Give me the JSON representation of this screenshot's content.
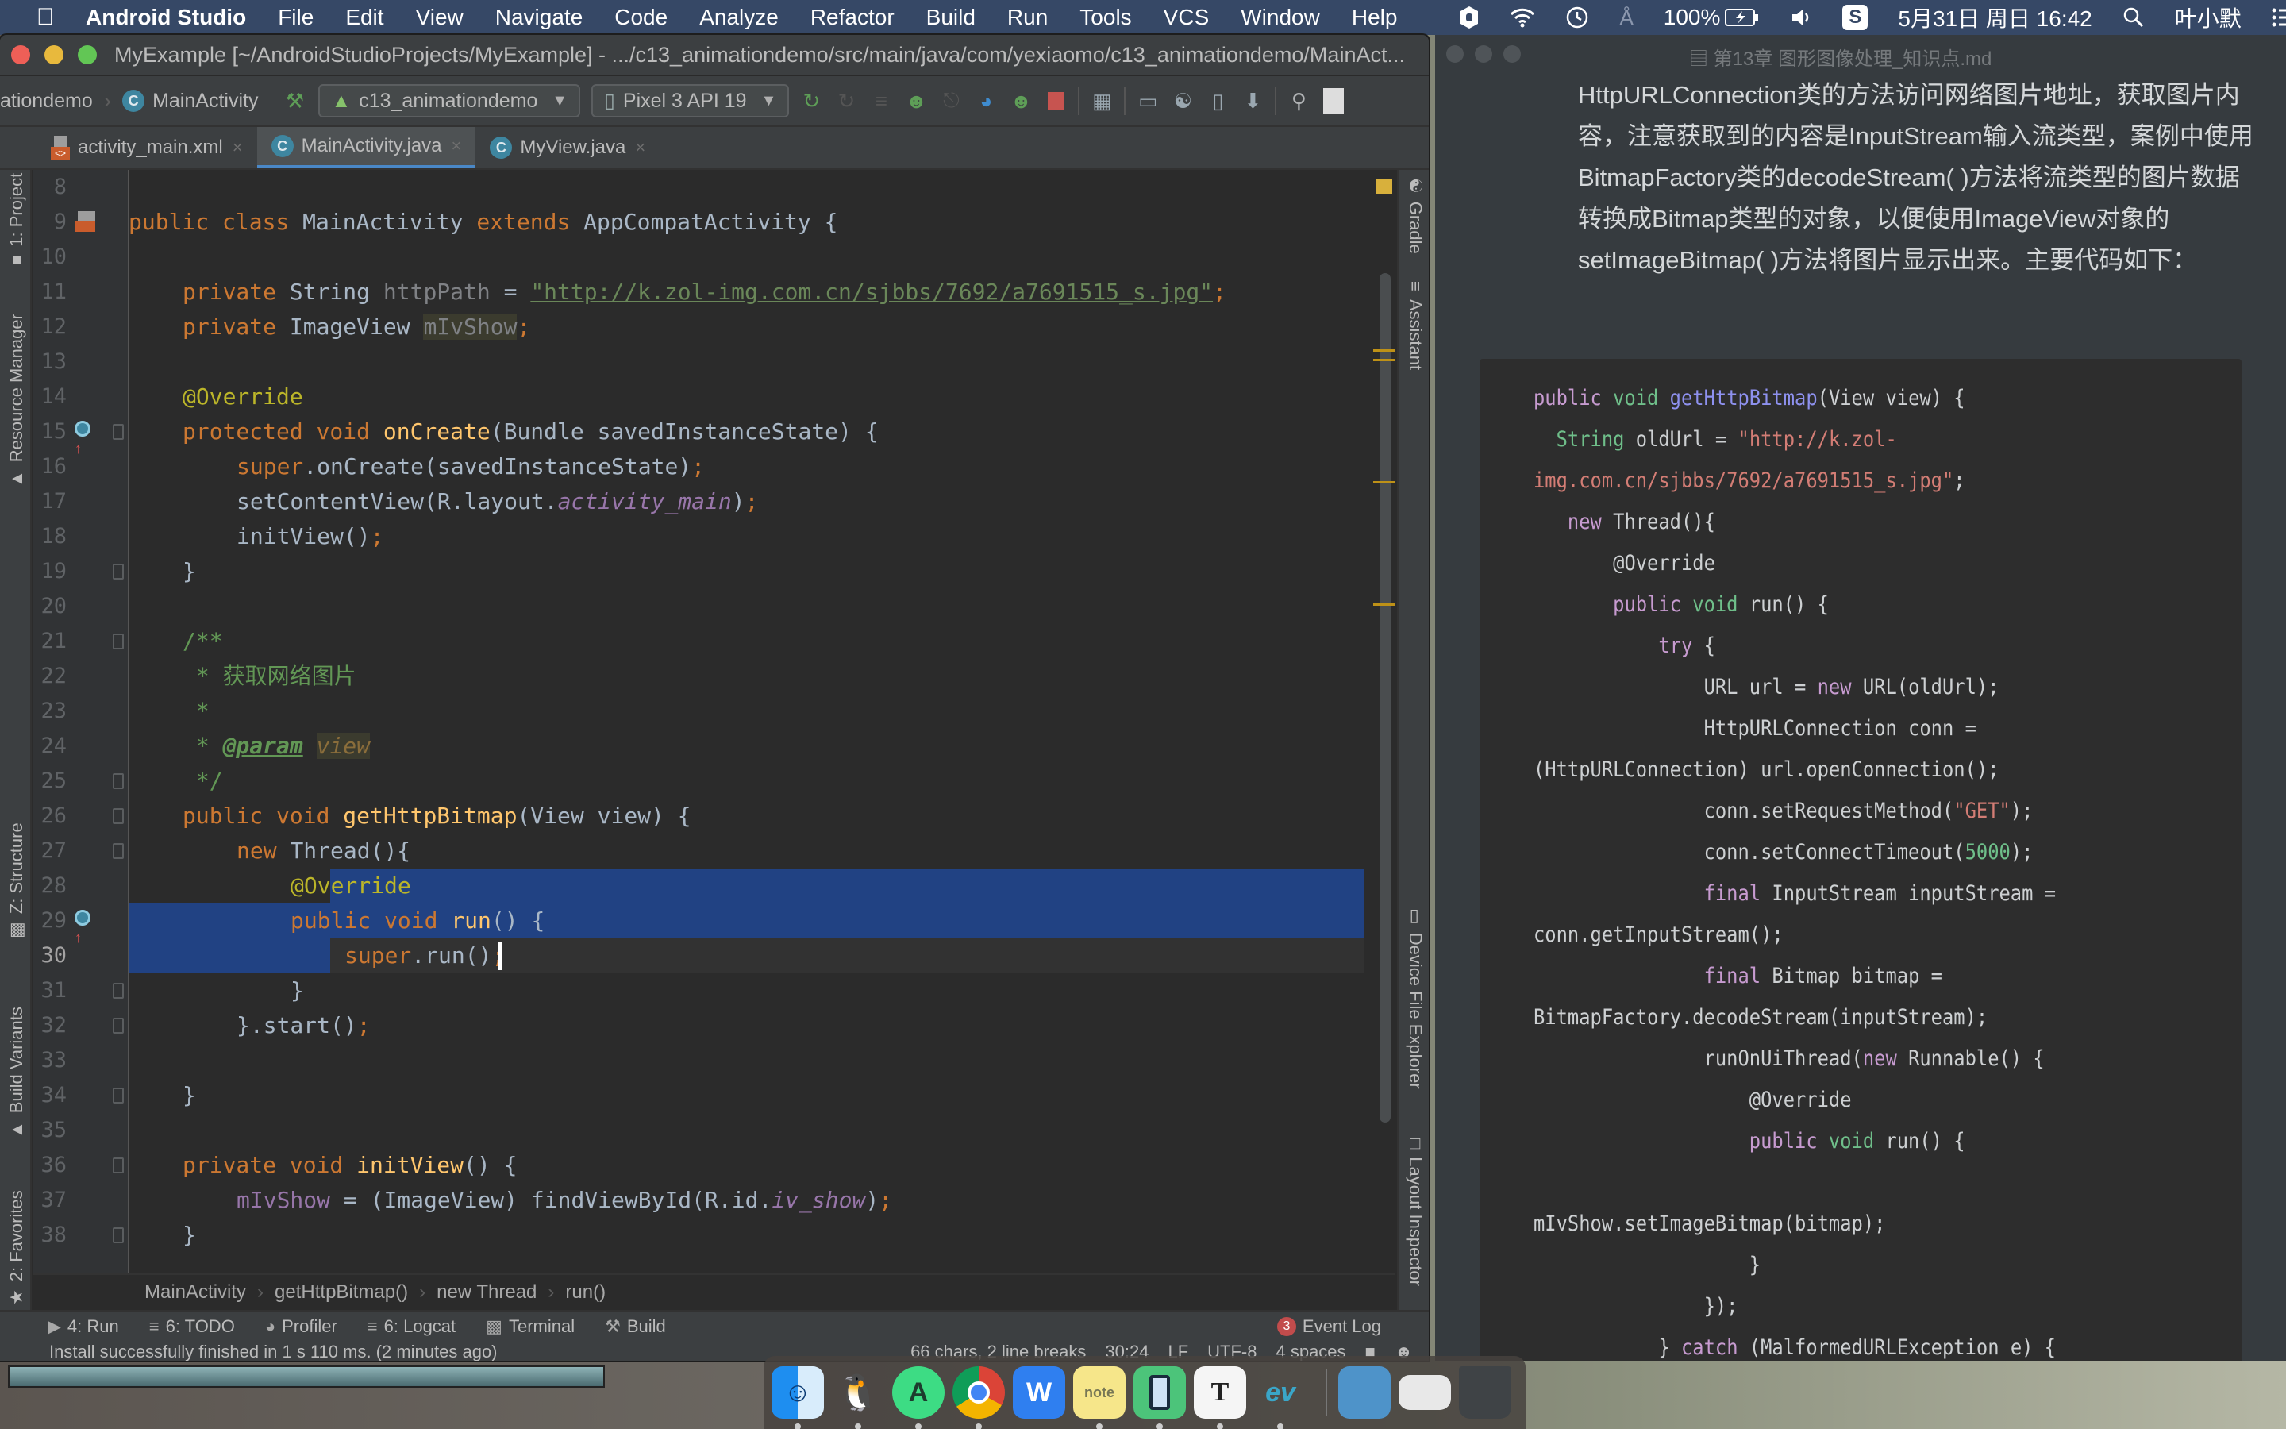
{
  "menubar": {
    "apple_icon": "apple-logo-icon",
    "app_name": "Android Studio",
    "items": [
      "File",
      "Edit",
      "View",
      "Navigate",
      "Code",
      "Analyze",
      "Refactor",
      "Build",
      "Run",
      "Tools",
      "VCS",
      "Window",
      "Help"
    ],
    "status": {
      "battery": "100%",
      "datetime": "5月31日 周日 16:42",
      "user": "叶小默"
    }
  },
  "as_window": {
    "title": "MyExample [~/AndroidStudioProjects/MyExample] - .../c13_animationdemo/src/main/java/com/yexiaomo/c13_animationdemo/MainAct...",
    "toolbar": {
      "breadcrumb_module": "ationdemo",
      "breadcrumb_class": "MainActivity",
      "run_config": "c13_animationdemo",
      "device": "Pixel 3 API 19"
    },
    "tabs": [
      {
        "label": "activity_main.xml",
        "icon": "xml-file-icon",
        "active": false
      },
      {
        "label": "MainActivity.java",
        "icon": "java-class-icon",
        "active": true
      },
      {
        "label": "MyView.java",
        "icon": "java-class-icon",
        "active": false
      }
    ],
    "left_tools": [
      "1: Project",
      "Resource Manager",
      "Z: Structure",
      "Build Variants",
      "2: Favorites"
    ],
    "right_tools": [
      "Gradle",
      "Assistant",
      "Device File Explorer",
      "Layout Inspector"
    ],
    "editor": {
      "line_numbers": [
        "8",
        "9",
        "10",
        "11",
        "12",
        "13",
        "14",
        "15",
        "16",
        "17",
        "18",
        "19",
        "20",
        "21",
        "22",
        "23",
        "24",
        "25",
        "26",
        "27",
        "28",
        "29",
        "30",
        "31",
        "32",
        "33",
        "34",
        "35",
        "36",
        "37",
        "38"
      ],
      "current_line": "30",
      "code": {
        "l9_a": "public class ",
        "l9_b": "MainActivity ",
        "l9_c": "extends ",
        "l9_d": "AppCompatActivity {",
        "l11_a": "private ",
        "l11_b": "String ",
        "l11_c": "httpPath",
        "l11_d": " = ",
        "l11_e": "\"http://k.zol-img.com.cn/sjbbs/7692/a7691515_s.jpg\"",
        "l11_f": ";",
        "l12_a": "private ",
        "l12_b": "ImageView ",
        "l12_c": "mIvShow",
        "l12_d": ";",
        "l14": "@Override",
        "l15_a": "protected void ",
        "l15_b": "onCreate",
        "l15_c": "(Bundle savedInstanceState) {",
        "l16_a": "super",
        "l16_b": ".onCreate(savedInstanceState)",
        "l16_c": ";",
        "l17_a": "setContentView(R.layout.",
        "l17_b": "activity_main",
        "l17_c": ")",
        "l17_d": ";",
        "l18_a": "initView()",
        "l18_b": ";",
        "l19": "}",
        "l21": "/**",
        "l22": " * 获取网络图片",
        "l23": " *",
        "l24_a": " * ",
        "l24_b": "@param",
        "l24_c": "view",
        "l25": " */",
        "l26_a": "public void ",
        "l26_b": "getHttpBitmap",
        "l26_c": "(View view) {",
        "l27_a": "new ",
        "l27_b": "Thread(){",
        "l28": "@Override",
        "l29_a": "public void ",
        "l29_b": "run",
        "l29_c": "() {",
        "l30_a": "super",
        "l30_b": ".run()",
        "l30_c": ";",
        "l31": "}",
        "l32_a": "}.start()",
        "l32_b": ";",
        "l34": "}",
        "l36_a": "private void ",
        "l36_b": "initView",
        "l36_c": "() {",
        "l37_a": "mIvShow",
        "l37_b": " = (ImageView) findViewById(R.id.",
        "l37_c": "iv_show",
        "l37_d": ")",
        "l37_e": ";",
        "l38": "}"
      }
    },
    "nav_breadcrumb": [
      "MainActivity",
      "getHttpBitmap()",
      "new Thread",
      "run()"
    ],
    "tool_tabs": [
      {
        "label": "4: Run",
        "icon": "run-icon"
      },
      {
        "label": "6: TODO",
        "icon": "todo-list-icon"
      },
      {
        "label": "Profiler",
        "icon": "profiler-icon"
      },
      {
        "label": "6: Logcat",
        "icon": "logcat-icon"
      },
      {
        "label": "Terminal",
        "icon": "terminal-icon"
      },
      {
        "label": "Build",
        "icon": "hammer-icon"
      }
    ],
    "event_log": {
      "count": "3",
      "label": "Event Log"
    },
    "status": {
      "message": "Install successfully finished in 1 s 110 ms. (2 minutes ago)",
      "selection": "66 chars, 2 line breaks",
      "position": "30:24",
      "line_sep": "LF",
      "encoding": "UTF-8",
      "indent": "4 spaces"
    }
  },
  "md_window": {
    "title": "第13章 图形图像处理_知识点.md",
    "paragraph": "HttpURLConnection类的方法访问网络图片地址，获取图片内容，注意获取到的内容是InputStream输入流类型，案例中使用BitmapFactory类的decodeStream( )方法将流类型的图片数据转换成Bitmap类型的对象，以便使用ImageView对象的setImageBitmap( )方法将图片显示出来。主要代码如下：",
    "code": {
      "c1a": "public ",
      "c1b": "void ",
      "c1c": "getHttpBitmap",
      "c1d": "(View view) {",
      "c2a": "  String ",
      "c2b": "oldUrl = ",
      "c2c": "\"http://k.zol-",
      "c3a": "img.com.cn/sjbbs/7692/a7691515_s.jpg\"",
      "c3b": ";",
      "c4a": "   new ",
      "c4b": "Thread(){",
      "c5": "       @Override",
      "c6a": "       public ",
      "c6b": "void ",
      "c6c": "run() {",
      "c7a": "           try ",
      "c7b": "{",
      "c8a": "               URL url = ",
      "c8b": "new ",
      "c8c": "URL(oldUrl);",
      "c9": "               HttpURLConnection conn =",
      "c10": "(HttpURLConnection) url.openConnection();",
      "c11a": "               conn.setRequestMethod(",
      "c11b": "\"GET\"",
      "c11c": ");",
      "c12a": "               conn.setConnectTimeout(",
      "c12b": "5000",
      "c12c": ");",
      "c13a": "               final ",
      "c13b": "InputStream inputStream =",
      "c14": "conn.getInputStream();",
      "c15a": "               final ",
      "c15b": "Bitmap bitmap =",
      "c16": "BitmapFactory.decodeStream(inputStream);",
      "c17a": "               runOnUiThread(",
      "c17b": "new ",
      "c17c": "Runnable() {",
      "c18": "                   @Override",
      "c19a": "                   public ",
      "c19b": "void ",
      "c19c": "run() {",
      "c20": "mIvShow.setImageBitmap(bitmap);",
      "c21": "                   }",
      "c22": "               });",
      "c23a": "           } ",
      "c23b": "catch ",
      "c23c": "(MalformedURLException e) {"
    }
  },
  "dock": {
    "apps": [
      "Finder",
      "QQ",
      "Android Studio",
      "Chrome",
      "WPS",
      "Stickies",
      "Simulator",
      "Typora",
      "EV Recorder",
      "Folder",
      "Preview",
      "Trash"
    ]
  }
}
